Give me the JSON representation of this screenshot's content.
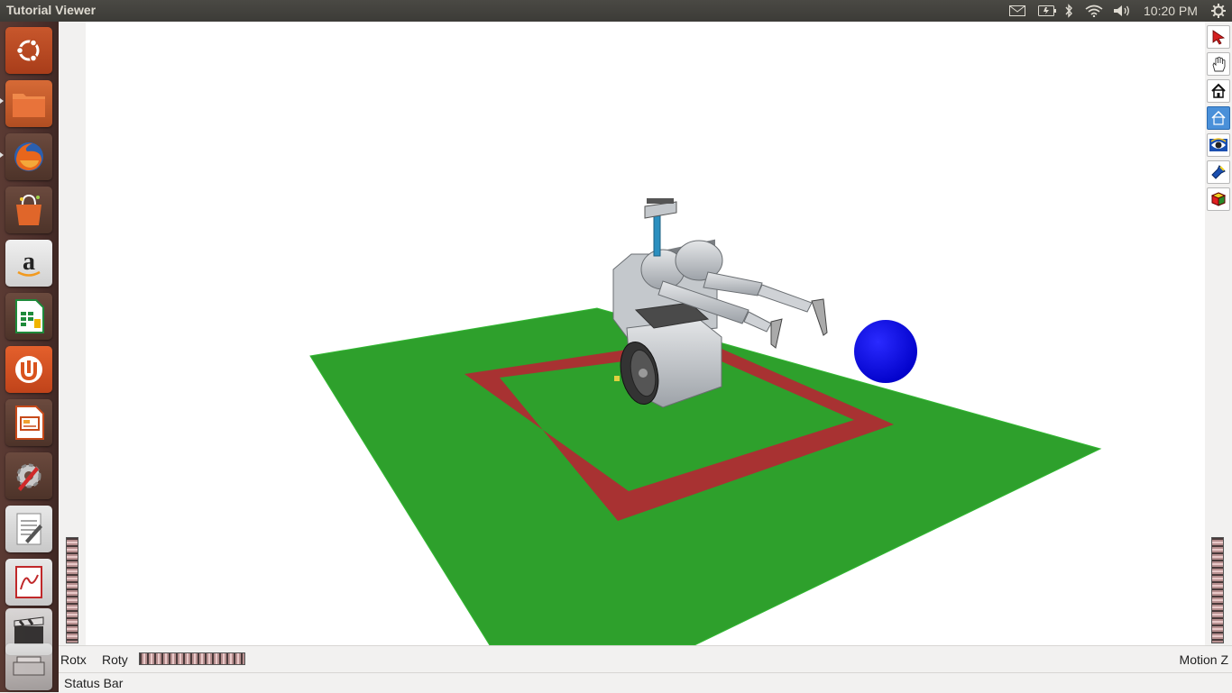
{
  "window": {
    "title": "Tutorial Viewer"
  },
  "top_panel": {
    "clock": "10:20 PM",
    "indicators": [
      "mail-icon",
      "battery-icon",
      "bluetooth-icon",
      "wifi-icon",
      "volume-icon",
      "gear-icon"
    ]
  },
  "launcher": {
    "items": [
      {
        "name": "ubuntu-dash-icon"
      },
      {
        "name": "files-icon"
      },
      {
        "name": "firefox-icon"
      },
      {
        "name": "software-center-icon"
      },
      {
        "name": "amazon-icon"
      },
      {
        "name": "calc-spreadsheet-icon"
      },
      {
        "name": "ubuntu-one-icon"
      },
      {
        "name": "impress-presentation-icon"
      },
      {
        "name": "system-settings-icon"
      },
      {
        "name": "text-editor-icon"
      },
      {
        "name": "pdf-viewer-icon"
      },
      {
        "name": "clapper-icon"
      },
      {
        "name": "scanner-icon"
      }
    ]
  },
  "viewer_toolbar": {
    "buttons": [
      {
        "name": "select-arrow-icon",
        "active": false
      },
      {
        "name": "pan-hand-icon",
        "active": false
      },
      {
        "name": "home-icon",
        "active": false
      },
      {
        "name": "set-home-icon",
        "active": true
      },
      {
        "name": "view-all-eye-icon",
        "active": false
      },
      {
        "name": "seek-flashlight-icon",
        "active": false
      },
      {
        "name": "projection-cube-icon",
        "active": false
      }
    ]
  },
  "thumbwheels": {
    "rotx_label": "Rotx",
    "roty_label": "Roty",
    "zoom_label": "Motion Z"
  },
  "statusbar": {
    "text": "Status Bar"
  },
  "scene": {
    "floor_color": "#2ea02c",
    "path_color": "#a83232",
    "ball_color": "#0000f0",
    "robot_color": "#b8bcc0"
  }
}
